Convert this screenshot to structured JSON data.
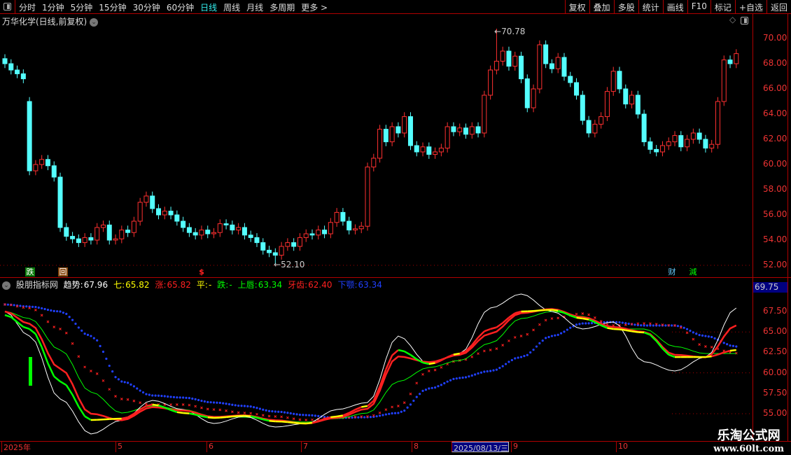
{
  "toolbar": {
    "periods": [
      "分时",
      "1分钟",
      "5分钟",
      "15分钟",
      "30分钟",
      "60分钟",
      "日线",
      "周线",
      "月线",
      "多周期",
      "更多 >"
    ],
    "active_period": "日线",
    "right_buttons": [
      "复权",
      "叠加",
      "多股",
      "统计",
      "画线",
      "F10",
      "标记",
      "+自选",
      "返回"
    ]
  },
  "chart_title": "万华化学(日线,前复权)",
  "price_axis": [
    "70.00",
    "68.00",
    "66.00",
    "64.00",
    "62.00",
    "60.00",
    "58.00",
    "56.00",
    "54.00",
    "52.00"
  ],
  "high_label": "70.78",
  "low_label": "52.10",
  "markers": {
    "die": "跌",
    "hui": "回",
    "dollar": "$",
    "cai": "财",
    "jian": "減"
  },
  "indicator": {
    "name": "股朋指标网",
    "items": [
      {
        "label": "趋势:",
        "value": "67.96",
        "color": "#ffffff"
      },
      {
        "label": "七:",
        "value": "65.82",
        "color": "#ffff00"
      },
      {
        "label": "涨:",
        "value": "65.82",
        "color": "#ff2020"
      },
      {
        "label": "平:",
        "value": "-",
        "color": "#ffff00"
      },
      {
        "label": "跌:",
        "value": "-",
        "color": "#00ff00"
      },
      {
        "label": "上唇:",
        "value": "63.34",
        "color": "#00ff00"
      },
      {
        "label": "牙齿:",
        "value": "62.40",
        "color": "#ff2020"
      },
      {
        "label": "下颚:",
        "value": "63.34",
        "color": "#2040ff"
      }
    ],
    "current_value": "69.75",
    "axis": [
      "67.50",
      "65.00",
      "62.50",
      "60.00",
      "57.50",
      "55.00"
    ]
  },
  "date_axis": {
    "labels": [
      "2025年",
      "5",
      "6",
      "7",
      "8",
      "9",
      "10"
    ],
    "current": "2025/08/13/三"
  },
  "watermark": {
    "line1": "乐淘公式网",
    "line2": "www.60lt.com"
  },
  "colors": {
    "up": "#ff3030",
    "down": "#54ffff",
    "border": "#b00000"
  },
  "chart_data": {
    "type": "candlestick",
    "closes": [
      68.0,
      67.5,
      67.2,
      66.8,
      59.5,
      60.0,
      60.4,
      59.9,
      59.0,
      55.0,
      54.3,
      54.1,
      53.8,
      54.2,
      54.0,
      55.0,
      55.2,
      54.0,
      54.1,
      54.8,
      54.6,
      55.5,
      57.0,
      57.5,
      56.5,
      56.0,
      56.3,
      56.0,
      55.5,
      55.0,
      54.6,
      54.4,
      54.8,
      54.5,
      54.6,
      55.3,
      55.2,
      54.8,
      55.0,
      54.4,
      54.2,
      53.8,
      53.2,
      53.0,
      52.8,
      53.5,
      53.8,
      53.5,
      54.2,
      54.5,
      54.4,
      54.8,
      54.5,
      55.4,
      56.2,
      55.5,
      54.8,
      54.9,
      55.1,
      59.8,
      60.5,
      62.8,
      61.8,
      63.0,
      62.5,
      63.8,
      61.5,
      61.0,
      61.4,
      60.8,
      61.0,
      61.3,
      63.0,
      62.6,
      62.9,
      62.4,
      63.0,
      62.5,
      65.5,
      67.5,
      68.2,
      69.0,
      67.8,
      68.6,
      66.8,
      64.5,
      66.0,
      69.5,
      68.0,
      67.6,
      68.5,
      67.0,
      66.5,
      65.5,
      63.5,
      62.5,
      63.2,
      63.8,
      65.8,
      67.4,
      66.0,
      64.8,
      65.5,
      64.0,
      61.8,
      61.2,
      61.0,
      61.5,
      61.8,
      62.3,
      61.4,
      62.0,
      62.5,
      62.0,
      61.3,
      61.6,
      65.0,
      68.3,
      68.0,
      68.8
    ],
    "first_open": 68.4,
    "big_drop_open": 65.0,
    "high": 70.78,
    "low": 52.1,
    "ylim": [
      51.5,
      71.2
    ],
    "indicator_ylim": [
      53.6,
      69.9
    ],
    "indicator_key_index": [
      0,
      4,
      9,
      14,
      19,
      24,
      29,
      34,
      39,
      44,
      49,
      54,
      59,
      64,
      69,
      74,
      79,
      84,
      89,
      94,
      99,
      104,
      109,
      114,
      119
    ],
    "series": [
      {
        "name": "趋势",
        "color": "#ffffff",
        "values": [
          67.5,
          64.5,
          56.8,
          52.52,
          54.2,
          56.63,
          55.51,
          53.8,
          54.66,
          53.37,
          53.8,
          55.51,
          56.37,
          64.5,
          61.08,
          62.36,
          67.93,
          69.64,
          67.5,
          65.36,
          66.22,
          61.36,
          60.22,
          61.93,
          67.93
        ]
      },
      {
        "name": "七",
        "color": "#00ff00",
        "values": [
          67.07,
          65.36,
          58.94,
          54.23,
          54.4,
          56.11,
          55.09,
          54.49,
          54.75,
          54.06,
          53.8,
          54.66,
          55.94,
          62.79,
          61.08,
          62.36,
          65.36,
          67.5,
          67.7,
          66.64,
          65.36,
          64.93,
          61.93,
          61.93,
          62.79
        ]
      },
      {
        "name": "涨",
        "color": "#ff2020",
        "values": [
          67.5,
          66.0,
          60.5,
          55.0,
          54.2,
          55.8,
          55.4,
          54.6,
          54.8,
          54.2,
          53.8,
          54.5,
          55.6,
          62.0,
          61.3,
          62.2,
          64.8,
          67.3,
          67.8,
          66.8,
          65.6,
          65.0,
          62.2,
          61.9,
          65.8
        ]
      },
      {
        "name": "上唇",
        "color": "#00ff00",
        "values": [
          67.5,
          66.64,
          62.79,
          57.65,
          55.09,
          55.94,
          55.51,
          54.66,
          54.57,
          54.23,
          53.97,
          54.4,
          55.09,
          58.94,
          60.65,
          61.51,
          63.65,
          66.64,
          67.5,
          66.9,
          65.36,
          65.36,
          63.22,
          62.36,
          62.36
        ]
      },
      {
        "name": "牙齿",
        "color": "#ff2020",
        "values": [
          68.36,
          67.93,
          65.36,
          60.22,
          56.8,
          56.11,
          56.11,
          55.51,
          55.09,
          54.66,
          54.23,
          54.49,
          54.66,
          55.94,
          60.22,
          61.51,
          62.79,
          64.5,
          66.64,
          67.24,
          65.79,
          66.04,
          65.79,
          63.22,
          62.4
        ]
      },
      {
        "name": "下颚",
        "color": "#2040ff",
        "values": [
          68.36,
          68.1,
          67.5,
          64.5,
          58.94,
          57.23,
          56.97,
          56.37,
          55.94,
          55.26,
          54.83,
          54.49,
          54.57,
          55.09,
          58.08,
          59.37,
          60.22,
          61.93,
          64.5,
          66.04,
          66.22,
          65.79,
          65.79,
          64.5,
          63.22
        ]
      }
    ]
  }
}
